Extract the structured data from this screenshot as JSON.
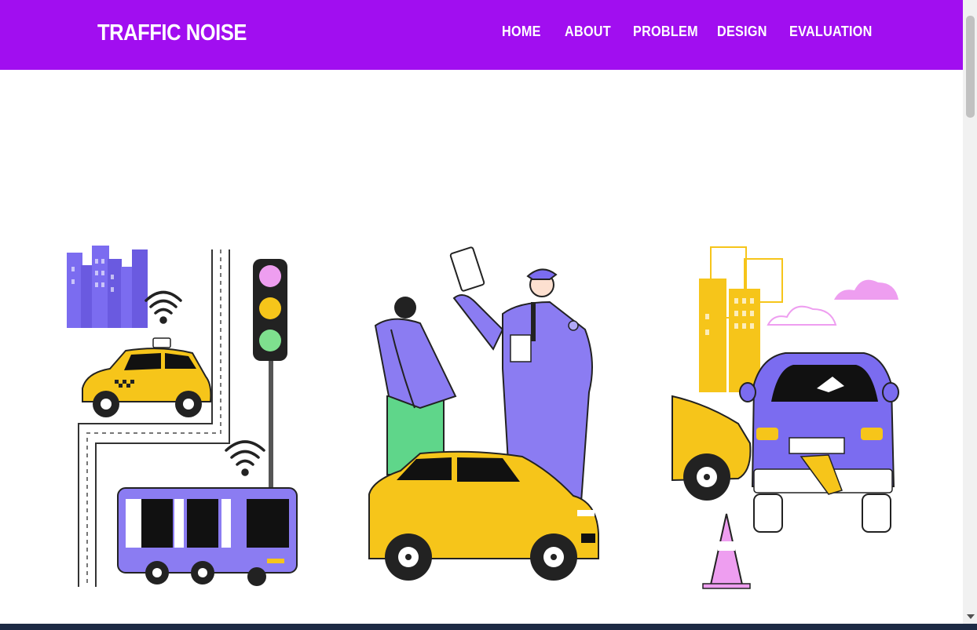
{
  "nav": {
    "brand": "TRAFFIC NOISE",
    "links": [
      "HOME",
      "ABOUT",
      "PROBLEM",
      "DESIGN",
      "EVALUATION"
    ]
  },
  "hero": {
    "illustrations": [
      "city-traffic-illustration",
      "police-officer-illustration",
      "car-crash-illustration"
    ]
  },
  "colors": {
    "navbar": "#a10ef0",
    "accent_purple": "#7b6cf0",
    "accent_yellow": "#f6c51a",
    "pink": "#ee9ef0"
  }
}
